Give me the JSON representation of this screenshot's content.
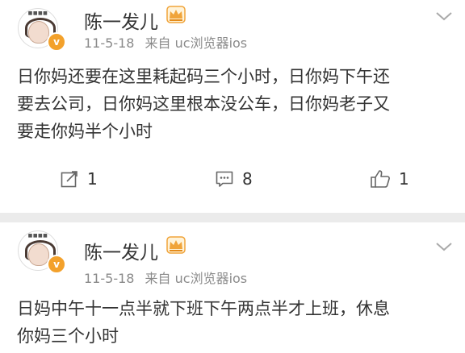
{
  "posts": [
    {
      "username": "陈一发儿",
      "avatar_caption": "■■■■",
      "verified_mark": "v",
      "date": "11-5-18",
      "source": "来自 uc浏览器ios",
      "lines": [
        "日你妈还要在这里耗起码三个小时，日你妈下午还",
        "要去公司，日你妈这里根本没公车，日你妈老子又",
        "要走你妈半个小时"
      ],
      "repost_count": "1",
      "comment_count": "8",
      "like_count": "1"
    },
    {
      "username": "陈一发儿",
      "avatar_caption": "■■■■",
      "verified_mark": "v",
      "date": "11-5-18",
      "source": "来自 uc浏览器ios",
      "lines": [
        "日妈中午十一点半就下班下午两点半才上班，休息",
        "你妈三个小时"
      ]
    }
  ],
  "colors": {
    "background": "#ebebeb",
    "card": "#ffffff",
    "meta_text": "#8a8a8a",
    "verified_badge": "#f3a12b",
    "crown": "#f0a43a"
  },
  "icons": [
    "crown-icon",
    "verified-badge-icon",
    "chevron-down-icon",
    "repost-icon",
    "comment-icon",
    "like-icon"
  ]
}
